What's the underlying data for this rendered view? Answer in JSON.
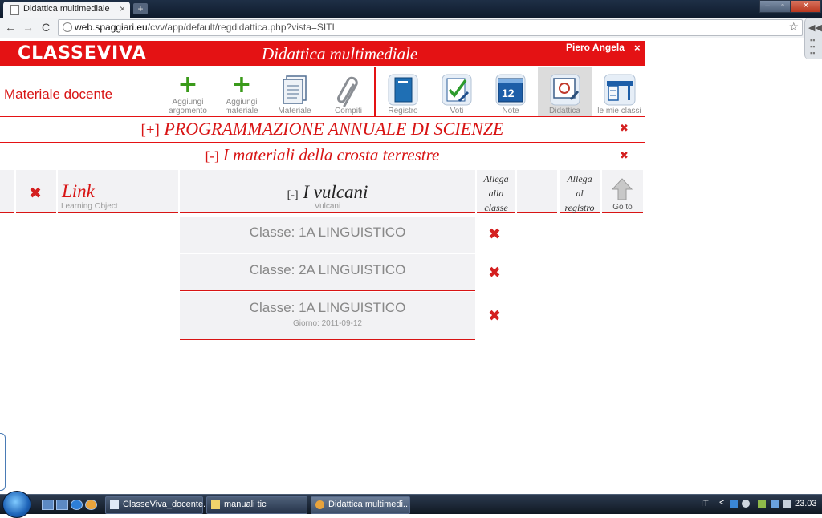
{
  "browser": {
    "tab_title": "Didattica multimediale",
    "tab_close": "×",
    "new_tab": "+",
    "url_host": "web.spaggiari.eu",
    "url_path": "/cvv/app/default/regdidattica.php?vista=SITI",
    "back": "←",
    "forward": "→",
    "reload": "C",
    "star": "☆",
    "win_min": "–",
    "win_max": "▫",
    "win_close": "✕"
  },
  "header": {
    "logo": "CLASSEVIVA",
    "title": "Didattica multimediale",
    "user": "Piero Angela",
    "close": "×"
  },
  "toolbar": {
    "section_label": "Materiale docente",
    "items": [
      {
        "label_line1": "Aggiungi",
        "label_line2": "argomento",
        "icon": "plus-icon"
      },
      {
        "label_line1": "Aggiungi",
        "label_line2": "materiale",
        "icon": "plus-icon"
      },
      {
        "label_line1": "Materiale",
        "icon": "documents-icon"
      },
      {
        "label_line1": "Compiti",
        "icon": "paperclip-icon"
      },
      {
        "label_line1": "Registro",
        "icon": "register-book-icon"
      },
      {
        "label_line1": "Voti",
        "icon": "grades-check-icon"
      },
      {
        "label_line1": "Note",
        "icon": "calendar-icon",
        "icon_text": "12"
      },
      {
        "label_line1": "Didattica",
        "icon": "didactics-icon"
      },
      {
        "label_line1": "le mie classi",
        "icon": "desk-icon"
      }
    ]
  },
  "programmazione": {
    "toggle": "[+]",
    "title": "PROGRAMMAZIONE ANNUALE DI SCIENZE",
    "delete": "✖"
  },
  "argomento": {
    "toggle": "[-]",
    "title": "I materiali della crosta terrestre",
    "delete": "✖"
  },
  "material": {
    "delete": "✖",
    "type_title": "Link",
    "type_sub": "Learning Object",
    "toggle": "[-]",
    "name": "I vulcani",
    "name_sub": "Vulcani",
    "col_allega_classe": [
      "Allega",
      "alla",
      "classe"
    ],
    "col_allega_registro": [
      "Allega",
      "al",
      "registro"
    ],
    "goto": "Go to"
  },
  "classes": [
    {
      "label": "Classe: 1A LINGUISTICO",
      "day": "",
      "delete": "✖"
    },
    {
      "label": "Classe: 2A LINGUISTICO",
      "day": "",
      "delete": "✖"
    },
    {
      "label": "Classe: 1A LINGUISTICO",
      "day": "Giorno: 2011-09-12",
      "delete": "✖"
    }
  ],
  "taskbar": {
    "tasks": [
      {
        "title": "ClasseViva_docente...."
      },
      {
        "title": "manuali tic"
      },
      {
        "title": "Didattica multimedi..."
      }
    ],
    "lang": "IT",
    "tray_arrow": "<",
    "clock": "23.03"
  },
  "colors": {
    "brand_red": "#e41214",
    "delete_red": "#d42020",
    "plus_green": "#3a9a1a"
  }
}
